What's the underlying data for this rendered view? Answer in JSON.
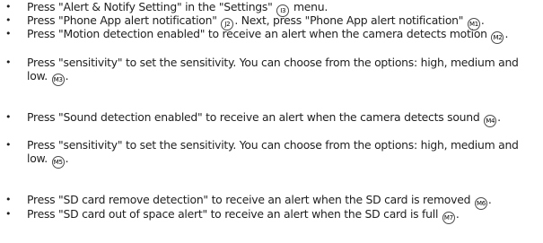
{
  "items": [
    {
      "parts": [
        "Press \"Alert & Notify Setting\" in the \"Settings\" ",
        " menu."
      ],
      "refs": [
        "I3"
      ]
    },
    {
      "parts": [
        "Press \"Phone App alert notification\" ",
        ". Next, press \"Phone App alert notification\" ",
        "."
      ],
      "refs": [
        "J2",
        "M1"
      ]
    },
    {
      "parts": [
        "Press \"Motion detection enabled\" to receive an alert when the camera detects motion ",
        "."
      ],
      "refs": [
        "M2"
      ]
    },
    {
      "parts": [
        "Press \"sensitivity\" to set the sensitivity. You can choose from the options: high, medium and low. ",
        "."
      ],
      "refs": [
        "M3"
      ]
    },
    {
      "parts": [
        "Press \"Sound detection enabled\" to receive an alert when the camera detects sound ",
        "."
      ],
      "refs": [
        "M4"
      ]
    },
    {
      "parts": [
        "Press \"sensitivity\" to set the sensitivity. You can choose from the options: high, medium and low. ",
        "."
      ],
      "refs": [
        "M5"
      ]
    },
    {
      "parts": [
        "Press \"SD card remove detection\" to receive an alert when the SD card is removed ",
        "."
      ],
      "refs": [
        "M6"
      ]
    },
    {
      "parts": [
        "Press \"SD card out of space alert\" to receive an alert when the SD card is full ",
        "."
      ],
      "refs": [
        "M7"
      ]
    }
  ]
}
